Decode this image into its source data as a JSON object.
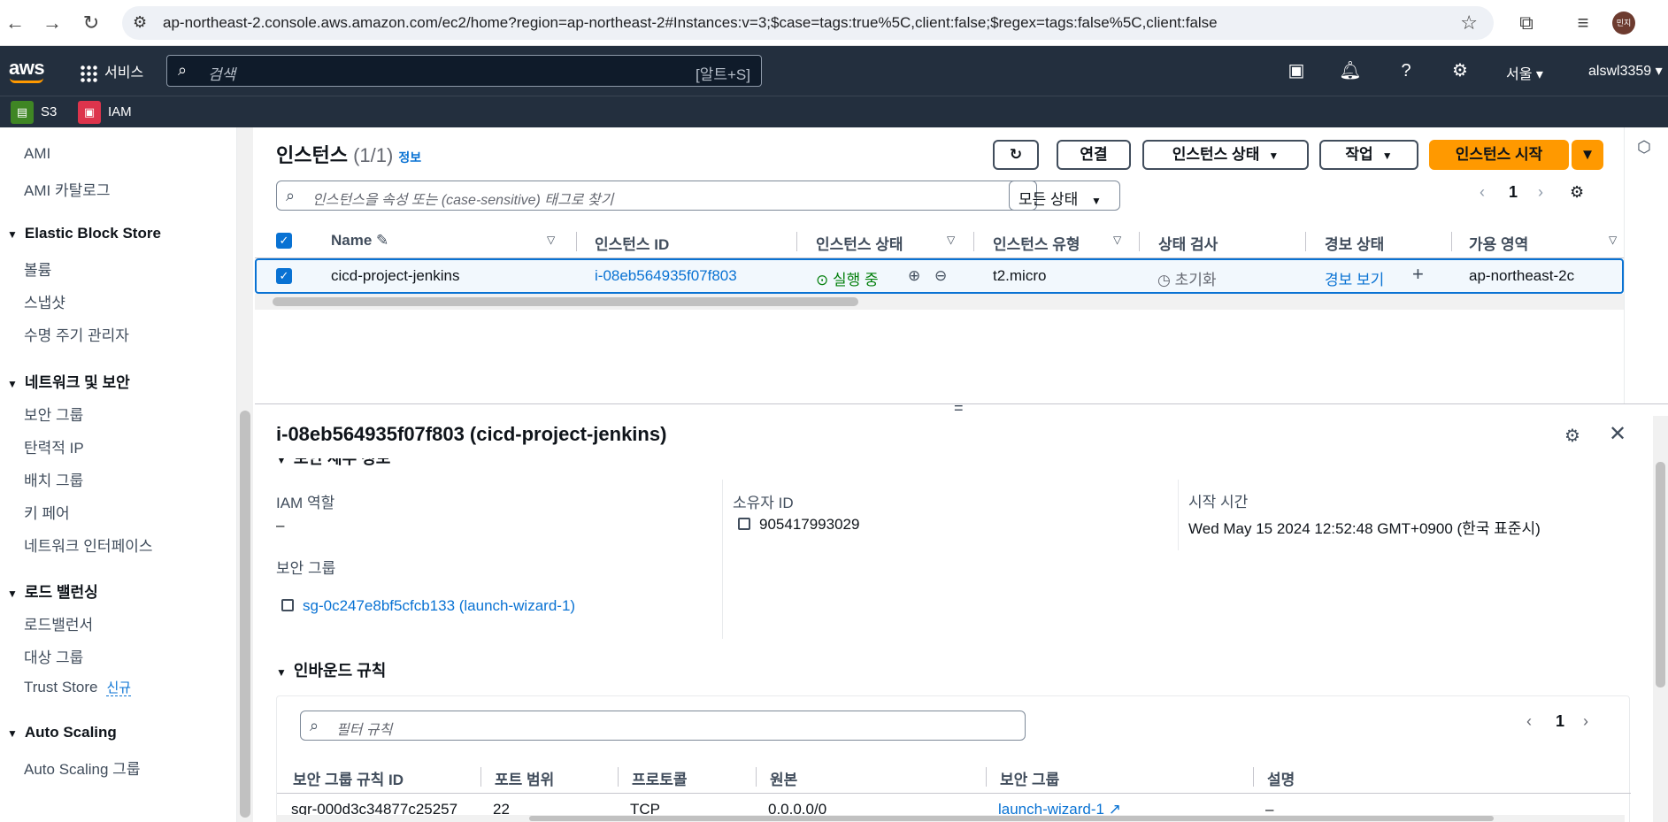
{
  "browser": {
    "url": "ap-northeast-2.console.aws.amazon.com/ec2/home?region=ap-northeast-2#Instances:v=3;$case=tags:true%5C,client:false;$regex=tags:false%5C,client:false",
    "profile": "민지"
  },
  "topnav": {
    "logo": "aws",
    "services": "서비스",
    "search_placeholder": "검색",
    "search_shortcut": "[알트+S]",
    "region": "서울",
    "account": "alswl3359"
  },
  "favorites": [
    {
      "label": "S3",
      "color": "#3f8624"
    },
    {
      "label": "IAM",
      "color": "#dd344c"
    }
  ],
  "sidebar": {
    "items_top": [
      "AMI",
      "AMI 카탈로그"
    ],
    "sections": [
      {
        "title": "Elastic Block Store",
        "items": [
          "볼륨",
          "스냅샷",
          "수명 주기 관리자"
        ]
      },
      {
        "title": "네트워크 및 보안",
        "items": [
          "보안 그룹",
          "탄력적 IP",
          "배치 그룹",
          "키 페어",
          "네트워크 인터페이스"
        ]
      },
      {
        "title": "로드 밸런싱",
        "items": [
          "로드밸런서",
          "대상 그룹",
          "Trust Store"
        ]
      },
      {
        "title": "Auto Scaling",
        "items": [
          "Auto Scaling 그룹"
        ]
      }
    ],
    "new_badge": "신규"
  },
  "instances": {
    "title": "인스턴스",
    "count": "(1/1)",
    "info": "정보",
    "buttons": {
      "connect": "연결",
      "state": "인스턴스 상태",
      "actions": "작업",
      "launch": "인스턴스 시작"
    },
    "filter_placeholder": "인스턴스을 속성 또는 (case-sensitive) 태그로 찾기",
    "state_filter": "모든 상태",
    "page": "1",
    "columns": [
      "Name",
      "인스턴스 ID",
      "인스턴스 상태",
      "인스턴스 유형",
      "상태 검사",
      "경보 상태",
      "가용 영역"
    ],
    "rows": [
      {
        "name": "cicd-project-jenkins",
        "id": "i-08eb564935f07f803",
        "state": "실행 중",
        "type": "t2.micro",
        "check": "초기화",
        "alarm": "경보 보기",
        "az": "ap-northeast-2c"
      }
    ]
  },
  "details": {
    "title": "i-08eb564935f07f803 (cicd-project-jenkins)",
    "cut_section": "보안 세부 정보",
    "iam_role_label": "IAM 역할",
    "iam_role_value": "–",
    "owner_label": "소유자 ID",
    "owner_value": "905417993029",
    "launch_label": "시작 시간",
    "launch_value": "Wed May 15 2024 12:52:48 GMT+0900 (한국 표준시)",
    "sg_label": "보안 그룹",
    "sg_value": "sg-0c247e8bf5cfcb133 (launch-wizard-1)",
    "inbound_title": "인바운드 규칙",
    "rule_filter_placeholder": "필터 규칙",
    "rule_page": "1",
    "rule_columns": [
      "보안 그룹 규칙 ID",
      "포트 범위",
      "프로토콜",
      "원본",
      "보안 그룹",
      "설명"
    ],
    "rules": [
      {
        "id": "sgr-000d3c34877c25257",
        "port": "22",
        "protocol": "TCP",
        "source": "0.0.0.0/0",
        "sg": "launch-wizard-1",
        "desc": "–"
      }
    ]
  }
}
